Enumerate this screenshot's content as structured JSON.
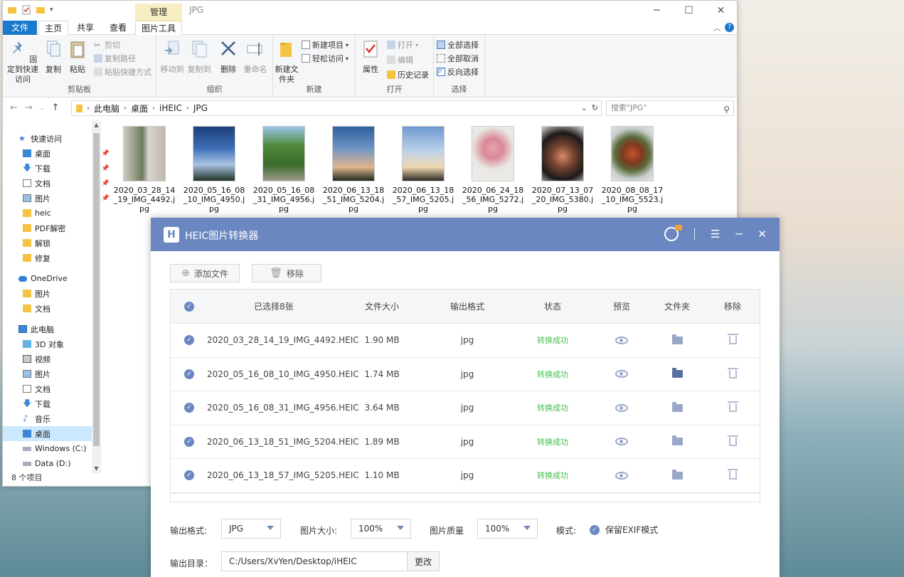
{
  "explorer": {
    "title": "JPG",
    "manage_tab": "管理",
    "tabs": {
      "file": "文件",
      "home": "主页",
      "share": "共享",
      "view": "查看",
      "picture_tools": "图片工具"
    },
    "window_controls": {
      "minimize": "─",
      "maximize": "☐",
      "close": "✕"
    },
    "ribbon": {
      "clipboard": {
        "label": "剪贴板",
        "pin": "固定到快速访问",
        "copy": "复制",
        "paste": "粘贴",
        "cut": "剪切",
        "copy_path": "复制路径",
        "paste_shortcut": "粘贴快捷方式"
      },
      "organize": {
        "label": "组织",
        "move_to": "移动到",
        "copy_to": "复制到",
        "delete": "删除",
        "rename": "重命名"
      },
      "new": {
        "label": "新建",
        "new_folder": "新建文件夹",
        "new_item": "新建项目",
        "easy_access": "轻松访问"
      },
      "open": {
        "label": "打开",
        "properties": "属性",
        "open": "打开",
        "edit": "编辑",
        "history": "历史记录"
      },
      "select": {
        "label": "选择",
        "select_all": "全部选择",
        "select_none": "全部取消",
        "invert": "反向选择"
      }
    },
    "breadcrumb": [
      "此电脑",
      "桌面",
      "iHEIC",
      "JPG"
    ],
    "search_placeholder": "搜索\"JPG\"",
    "nav": {
      "quick_access": "快速访问",
      "quick_items": [
        "桌面",
        "下载",
        "文档",
        "图片",
        "heic",
        "PDF解密",
        "解锁",
        "修复"
      ],
      "onedrive": "OneDrive",
      "onedrive_items": [
        "图片",
        "文档"
      ],
      "this_pc": "此电脑",
      "pc_items": [
        "3D 对象",
        "视频",
        "图片",
        "文档",
        "下载",
        "音乐",
        "桌面",
        "Windows (C:)",
        "Data (D:)"
      ]
    },
    "status": "8 个项目",
    "files": [
      "2020_03_28_14_19_IMG_4492.jpg",
      "2020_05_16_08_10_IMG_4950.jpg",
      "2020_05_16_08_31_IMG_4956.jpg",
      "2020_06_13_18_51_IMG_5204.jpg",
      "2020_06_13_18_57_IMG_5205.jpg",
      "2020_06_24_18_56_IMG_5272.jpg",
      "2020_07_13_07_20_IMG_5380.jpg",
      "2020_08_08_17_10_IMG_5523.jpg"
    ]
  },
  "heic": {
    "title": "HEIC图片转换器",
    "logo_letter": "H",
    "add_file": "添加文件",
    "remove": "移除",
    "columns": {
      "selected": "已选择8张",
      "size": "文件大小",
      "format": "输出格式",
      "status": "状态",
      "preview": "预览",
      "folder": "文件夹",
      "remove": "移除"
    },
    "rows": [
      {
        "name": "2020_03_28_14_19_IMG_4492.HEIC",
        "size": "1.90 MB",
        "format": "jpg",
        "status": "转换成功"
      },
      {
        "name": "2020_05_16_08_10_IMG_4950.HEIC",
        "size": "1.74 MB",
        "format": "jpg",
        "status": "转换成功"
      },
      {
        "name": "2020_05_16_08_31_IMG_4956.HEIC",
        "size": "3.64 MB",
        "format": "jpg",
        "status": "转换成功"
      },
      {
        "name": "2020_06_13_18_51_IMG_5204.HEIC",
        "size": "1.89 MB",
        "format": "jpg",
        "status": "转换成功"
      },
      {
        "name": "2020_06_13_18_57_IMG_5205.HEIC",
        "size": "1.10 MB",
        "format": "jpg",
        "status": "转换成功"
      }
    ],
    "options": {
      "format_label": "输出格式:",
      "format_value": "JPG",
      "size_label": "图片大小:",
      "size_value": "100%",
      "quality_label": "图片质量",
      "quality_value": "100%",
      "mode_label": "模式:",
      "exif_label": "保留EXIF模式",
      "dir_label": "输出目录：",
      "dir_value": "C:/Users/XvYen/Desktop/iHEIC",
      "change": "更改"
    },
    "colors": {
      "header": "#6a87c1",
      "success": "#3ec34a"
    }
  }
}
